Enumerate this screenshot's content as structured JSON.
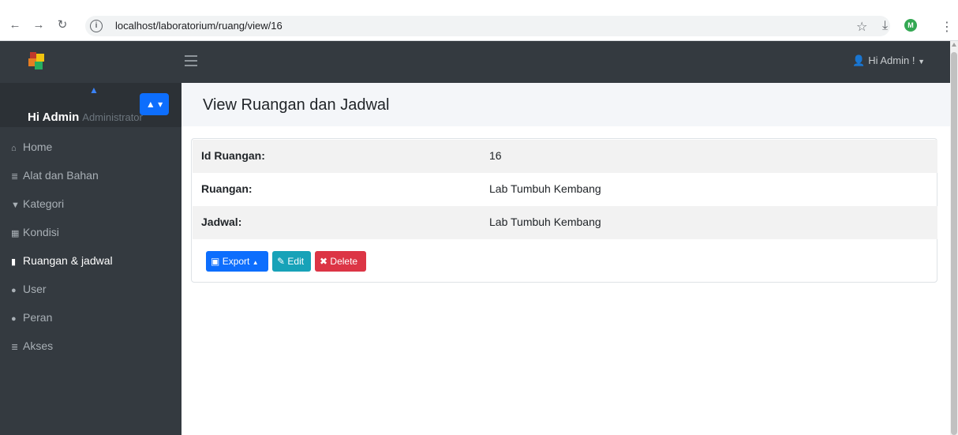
{
  "browser": {
    "url": "localhost/laboratorium/ruang/view/16",
    "profile_initial": "M"
  },
  "navbar": {
    "user_menu": "Hi Admin !"
  },
  "sidebar": {
    "user_name": "Hi Admin",
    "user_role": "Administrator",
    "items": [
      {
        "label": "Home",
        "icon": "home-icon"
      },
      {
        "label": "Alat dan Bahan",
        "icon": "database-icon"
      },
      {
        "label": "Kategori",
        "icon": "filter-icon"
      },
      {
        "label": "Kondisi",
        "icon": "calculator-icon"
      },
      {
        "label": "Ruangan & jadwal",
        "icon": "file-icon",
        "active": true
      },
      {
        "label": "User",
        "icon": "user-icon"
      },
      {
        "label": "Peran",
        "icon": "user-plus-icon"
      },
      {
        "label": "Akses",
        "icon": "database-icon"
      }
    ]
  },
  "main": {
    "title": "View Ruangan dan Jadwal",
    "rows": [
      {
        "label": "Id Ruangan:",
        "value": "16"
      },
      {
        "label": "Ruangan:",
        "value": "Lab Tumbuh Kembang"
      },
      {
        "label": "Jadwal:",
        "value": "Lab Tumbuh Kembang"
      }
    ],
    "buttons": {
      "export": "Export",
      "edit": "Edit",
      "delete": "Delete"
    }
  },
  "colors": {
    "sidebar_bg": "#343a40",
    "primary": "#0d6efd",
    "info": "#17a2b8",
    "danger": "#dc3545"
  }
}
